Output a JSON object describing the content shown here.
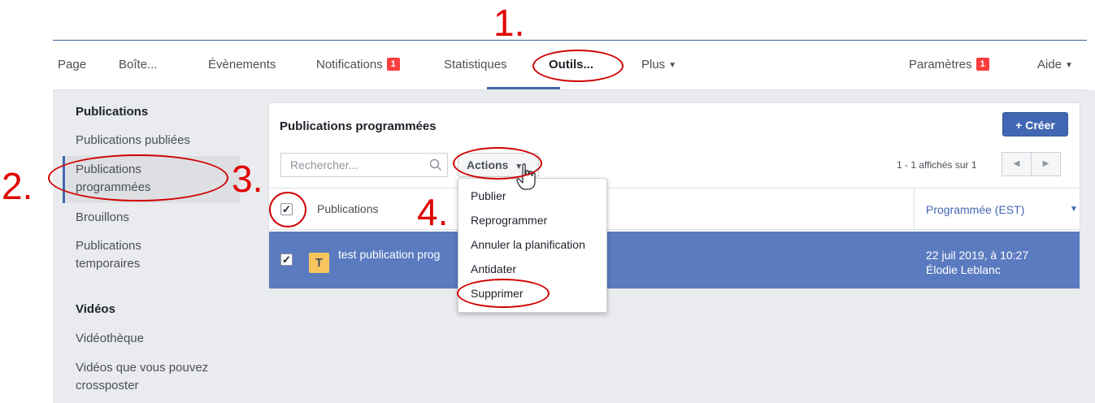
{
  "nav": {
    "items": [
      "Page",
      "Boîte...",
      "Évènements",
      "Notifications",
      "Statistiques",
      "Outils...",
      "Plus",
      "Paramètres",
      "Aide"
    ],
    "notifications_badge": "1",
    "parametres_badge": "1",
    "active": "Outils..."
  },
  "sidebar": {
    "publications_heading": "Publications",
    "pub_items": [
      "Publications publiées",
      "Publications",
      "programmées",
      "Brouillons",
      "Publications",
      "temporaires"
    ],
    "videos_heading": "Vidéos",
    "video_items": [
      "Vidéothèque",
      "Vidéos que vous pouvez",
      "crossposter"
    ]
  },
  "main": {
    "title": "Publications programmées",
    "create_label": "+ Créer",
    "search_placeholder": "Rechercher...",
    "actions_label": "Actions",
    "pager_text": "1 - 1 affichés sur 1",
    "col_publications": "Publications",
    "col_scheduled": "Programmée (EST)",
    "row": {
      "avatar_letter": "T",
      "title": "test publication prog",
      "date": "22 juil 2019, à 10:27",
      "author": "Élodie Leblanc"
    }
  },
  "menu": {
    "items": [
      "Publier",
      "Reprogrammer",
      "Annuler la planification",
      "Antidater",
      "Supprimer"
    ]
  },
  "annotations": {
    "step1": "1.",
    "step2": "2.",
    "step3": "3.",
    "step4": "4."
  },
  "colors": {
    "accent": "#4267b2",
    "row_selected": "#5b7bc0",
    "annotation": "#e00000",
    "badge": "#fa3e3e"
  }
}
